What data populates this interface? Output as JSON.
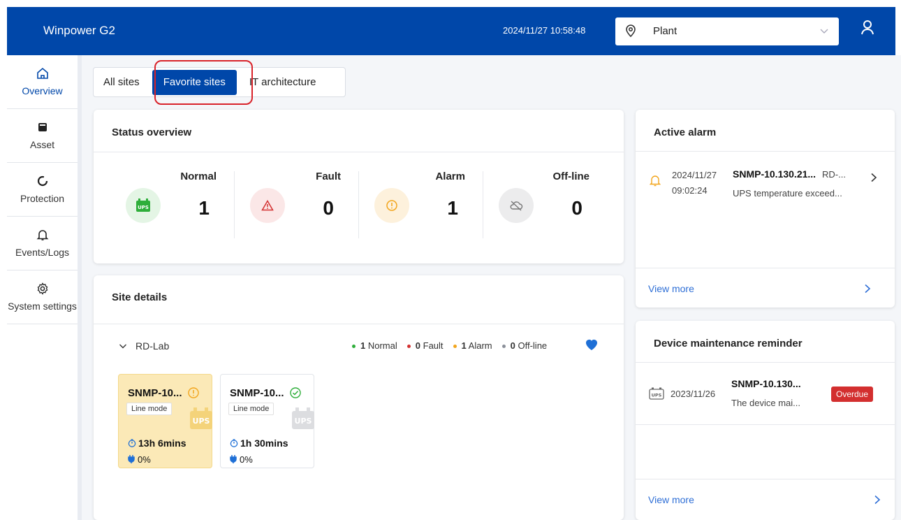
{
  "header": {
    "app_title": "Winpower G2",
    "datetime": "2024/11/27 10:58:48",
    "site_select": {
      "value": "Plant"
    }
  },
  "sidebar": {
    "items": [
      {
        "label": "Overview",
        "icon": "home-icon"
      },
      {
        "label": "Asset",
        "icon": "asset-icon"
      },
      {
        "label": "Protection",
        "icon": "protection-icon"
      },
      {
        "label": "Events/Logs",
        "icon": "bell-icon"
      },
      {
        "label": "System settings",
        "icon": "gear-icon"
      }
    ]
  },
  "tabs": [
    {
      "label": "All sites"
    },
    {
      "label": "Favorite sites"
    },
    {
      "label": "IT architecture"
    }
  ],
  "status_overview": {
    "title": "Status overview",
    "stats": [
      {
        "label": "Normal",
        "value": "1",
        "icon": "ups-icon"
      },
      {
        "label": "Fault",
        "value": "0",
        "icon": "warning-triangle-icon"
      },
      {
        "label": "Alarm",
        "value": "1",
        "icon": "exclamation-circle-icon"
      },
      {
        "label": "Off-line",
        "value": "0",
        "icon": "cloud-offline-icon"
      }
    ]
  },
  "site_details": {
    "title": "Site details",
    "group": {
      "name": "RD-Lab",
      "legend": [
        {
          "count": "1",
          "label": "Normal",
          "color": "#2eae3a"
        },
        {
          "count": "0",
          "label": "Fault",
          "color": "#d32f2f"
        },
        {
          "count": "1",
          "label": "Alarm",
          "color": "#f2a51c"
        },
        {
          "count": "0",
          "label": "Off-line",
          "color": "#8a8f99"
        }
      ]
    },
    "devices": [
      {
        "name": "SNMP-10...",
        "mode": "Line mode",
        "runtime": "13h 6mins",
        "load": "0%",
        "status": "alarm"
      },
      {
        "name": "SNMP-10...",
        "mode": "Line mode",
        "runtime": "1h 30mins",
        "load": "0%",
        "status": "normal"
      }
    ]
  },
  "active_alarm": {
    "title": "Active alarm",
    "item": {
      "date": "2024/11/27",
      "time": "09:02:24",
      "device": "SNMP-10.130.21...",
      "site": "RD-...",
      "message": "UPS temperature exceed..."
    },
    "view_more": "View more"
  },
  "maintenance": {
    "title": "Device maintenance reminder",
    "item": {
      "date": "2023/11/26",
      "device": "SNMP-10.130...",
      "message": "The device mai...",
      "badge": "Overdue"
    },
    "view_more": "View more"
  },
  "colors": {
    "brand": "#0047a9",
    "normal": "#2eae3a",
    "fault": "#d32f2f",
    "alarm": "#f2a51c",
    "offline": "#8a8f99"
  }
}
